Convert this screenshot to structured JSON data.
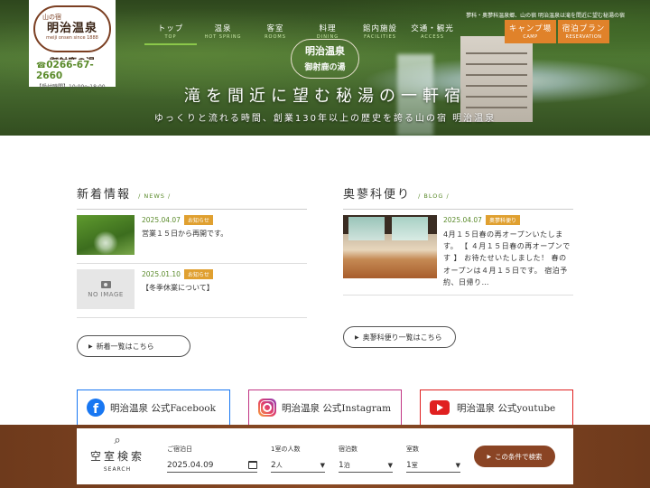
{
  "header": {
    "logo": {
      "top": "山の宿",
      "name": "明治温泉",
      "since": "meiji onsen since 1888",
      "sub": "御射鹿の湯"
    },
    "phone": "0266-67-2660",
    "phone_icon": "☎",
    "hours": "【受付時間】10:00～18:00",
    "top_note": "蓼科・奥蓼科温泉郷、山の宿 明治温泉は滝を間近に望む秘湯の宿",
    "nav": [
      {
        "jp": "トップ",
        "en": "TOP"
      },
      {
        "jp": "温泉",
        "en": "HOT SPRING"
      },
      {
        "jp": "客室",
        "en": "ROOMS"
      },
      {
        "jp": "料理",
        "en": "DINING"
      },
      {
        "jp": "館内施設",
        "en": "FACILITIES"
      },
      {
        "jp": "交通・観光",
        "en": "ACCESS"
      }
    ],
    "nav_buttons": [
      {
        "jp": "キャンプ場",
        "en": "CAMP"
      },
      {
        "jp": "宿泊プラン",
        "en": "RESERVATION"
      }
    ],
    "center_logo": {
      "a": "明治温泉",
      "b": "御射鹿の湯"
    },
    "hero_title": "滝を間近に望む秘湯の一軒宿",
    "hero_sub": "ゆっくりと流れる時間、創業130年以上の歴史を誇る山の宿 明治温泉"
  },
  "news": {
    "title": "新着情報",
    "title_en": "/ NEWS /",
    "items": [
      {
        "date": "2025.04.07",
        "tag": "お知らせ",
        "text": "営業１５日から再開です。"
      },
      {
        "date": "2025.01.10",
        "tag": "お知らせ",
        "text": "【冬季休業について】",
        "noimage": "NO IMAGE"
      }
    ],
    "more": "新着一覧はこちら"
  },
  "blog": {
    "title": "奥蓼科便り",
    "title_en": "/ BLOG /",
    "item": {
      "date": "2025.04.07",
      "tag": "奥蓼科便り",
      "text": "4月１５日春の再オープンいたします。 【 ４月１５日春の再オープンです 】 お待たせいたしました！ 春のオープンは４月１５日です。 宿泊予約、日帰り…"
    },
    "more": "奥蓼科便り一覧はこちら"
  },
  "sns": {
    "facebook": "明治温泉 公式Facebook",
    "instagram": "明治温泉 公式Instagram",
    "youtube": "明治温泉 公式youtube"
  },
  "search": {
    "title": "空室検索",
    "title_en": "SEARCH",
    "date_label": "ご宿泊日",
    "date_value": "2025.04.09",
    "people_label": "1室の人数",
    "people_value": "2",
    "people_unit": "人",
    "nights_label": "宿泊数",
    "nights_value": "1",
    "nights_unit": "泊",
    "rooms_label": "室数",
    "rooms_value": "1",
    "rooms_unit": "室",
    "button": "この条件で検索"
  },
  "colors": {
    "accent_green": "#5a8a2a",
    "orange": "#e0822a",
    "brown": "#8a4424"
  }
}
